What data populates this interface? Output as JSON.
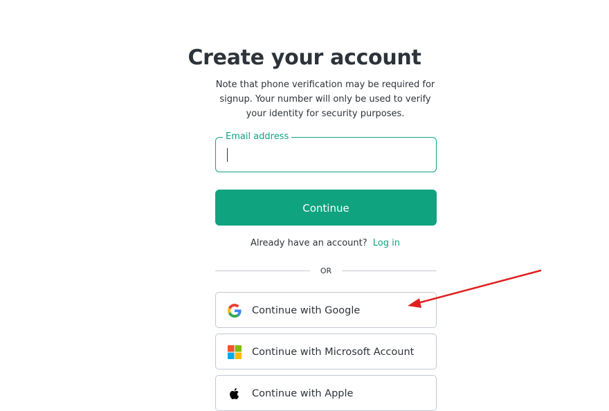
{
  "page": {
    "title": "Create your account",
    "subtitle": "Note that phone verification may be required for signup. Your number will only be used to verify your identity for security purposes."
  },
  "email": {
    "label": "Email address",
    "value": ""
  },
  "continue_button": {
    "label": "Continue"
  },
  "login_prompt": {
    "text": "Already have an account?",
    "link": "Log in"
  },
  "divider": {
    "text": "OR"
  },
  "social": [
    {
      "label": "Continue with Google",
      "icon": "google-icon"
    },
    {
      "label": "Continue with Microsoft Account",
      "icon": "microsoft-icon"
    },
    {
      "label": "Continue with Apple",
      "icon": "apple-icon"
    }
  ],
  "colors": {
    "accent": "#10a37f",
    "text": "#2d333a",
    "border": "#c2c8d0",
    "annotation_arrow": "#e02020"
  }
}
